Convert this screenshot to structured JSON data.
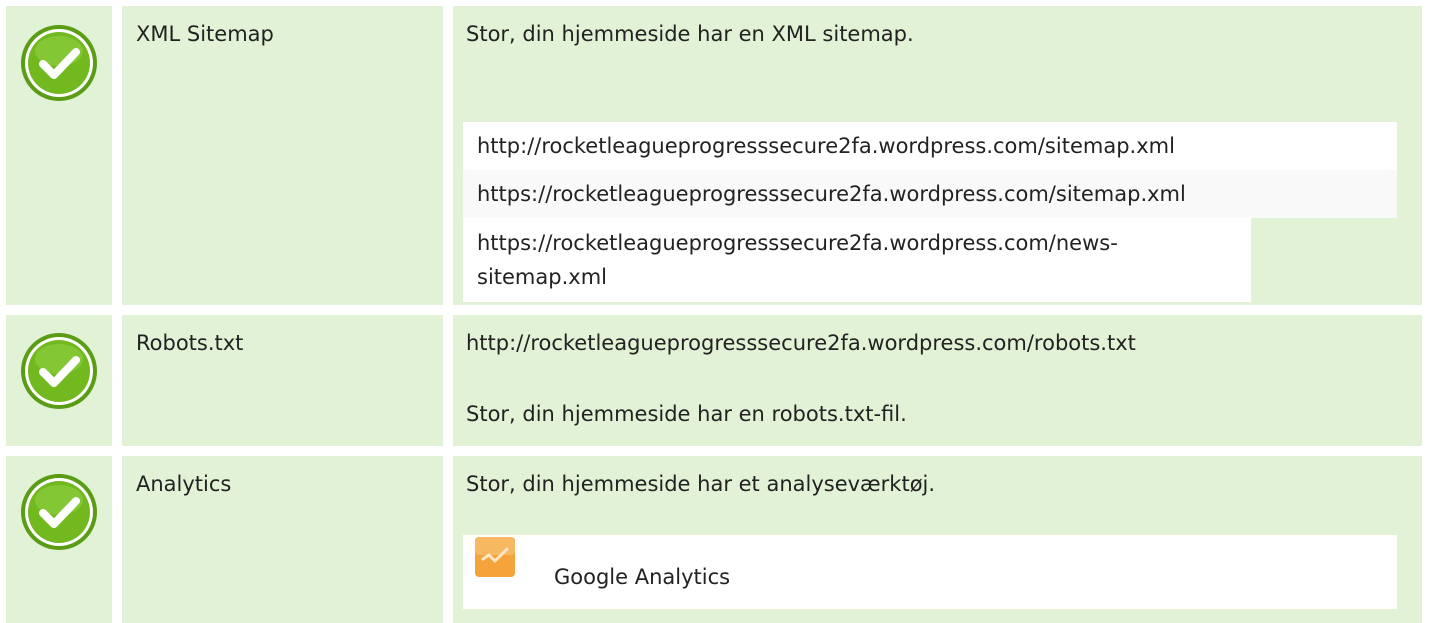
{
  "rows": [
    {
      "name": "XML Sitemap",
      "status": "check-icon",
      "message": "Stor, din hjemmeside har en XML sitemap.",
      "sitemaps": [
        "http://rocketleagueprogresssecure2fa.wordpress.com/sitemap.xml",
        "https://rocketleagueprogresssecure2fa.wordpress.com/sitemap.xml",
        "https://rocketleagueprogresssecure2fa.wordpress.com/news-sitemap.xml"
      ]
    },
    {
      "name": "Robots.txt",
      "status": "check-icon",
      "url": "http://rocketleagueprogresssecure2fa.wordpress.com/robots.txt",
      "message": "Stor, din hjemmeside har en robots.txt-fil."
    },
    {
      "name": "Analytics",
      "status": "check-icon",
      "message": "Stor, din hjemmeside har et analyseværktøj.",
      "tool": {
        "icon": "google-analytics-icon",
        "label": "Google Analytics"
      }
    }
  ],
  "colors": {
    "cell_bg": "#e1f2d6",
    "check_green": "#6fb71d",
    "analytics_orange": "#f4a43b"
  }
}
